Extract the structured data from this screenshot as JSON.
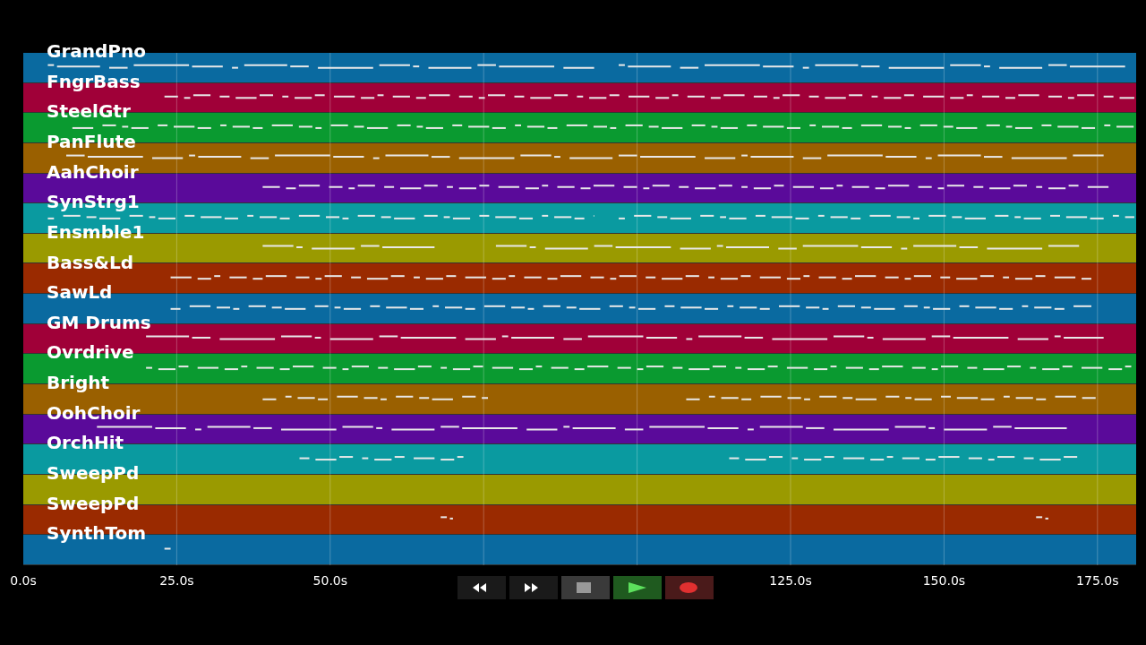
{
  "tracks": [
    {
      "name": "GrandPno",
      "color": "#0a6aa0"
    },
    {
      "name": "FngrBass",
      "color": "#a00038"
    },
    {
      "name": "SteelGtr",
      "color": "#0a9a30"
    },
    {
      "name": "PanFlute",
      "color": "#9a6000"
    },
    {
      "name": "AahChoir",
      "color": "#5a0a9a"
    },
    {
      "name": "SynStrg1",
      "color": "#0a9aa0"
    },
    {
      "name": "Ensmble1",
      "color": "#9a9a00"
    },
    {
      "name": "Bass&Ld",
      "color": "#9a2a00"
    },
    {
      "name": "SawLd",
      "color": "#0a6aa0"
    },
    {
      "name": "GM Drums",
      "color": "#a00038"
    },
    {
      "name": "Ovrdrive",
      "color": "#0a9a30"
    },
    {
      "name": "Bright",
      "color": "#9a6000"
    },
    {
      "name": "OohChoir",
      "color": "#5a0a9a"
    },
    {
      "name": "OrchHit",
      "color": "#0a9aa0"
    },
    {
      "name": "SweepPd",
      "color": "#9a9a00"
    },
    {
      "name": "SweepPd",
      "color": "#9a2a00"
    },
    {
      "name": "SynthTom",
      "color": "#0a6aa0"
    }
  ],
  "time_axis": {
    "ticks": [
      "0.0s",
      "25.0s",
      "50.0s",
      "125.0s",
      "150.0s",
      "175.0s"
    ]
  },
  "transport": [
    {
      "kind": "rewind"
    },
    {
      "kind": "forward"
    },
    {
      "kind": "stop"
    },
    {
      "kind": "play"
    },
    {
      "kind": "record"
    }
  ]
}
